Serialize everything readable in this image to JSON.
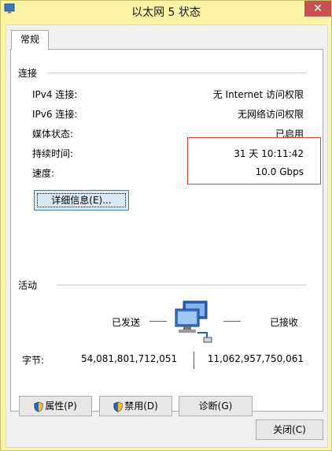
{
  "window": {
    "title": "以太网 5 状态",
    "close_glyph": "✕"
  },
  "tabs": [
    {
      "label": "常规"
    }
  ],
  "connection": {
    "heading": "连接",
    "rows": [
      {
        "label": "IPv4 连接:",
        "value": "无 Internet 访问权限"
      },
      {
        "label": "IPv6 连接:",
        "value": "无网络访问权限"
      },
      {
        "label": "媒体状态:",
        "value": "已启用"
      },
      {
        "label": "持续时间:",
        "value": "31 天 10:11:42"
      },
      {
        "label": "速度:",
        "value": "10.0 Gbps"
      }
    ],
    "details_button": "详细信息(E)..."
  },
  "activity": {
    "heading": "活动",
    "sent_label": "已发送",
    "received_label": "已接收",
    "bytes_label": "字节:",
    "bytes_sent": "54,081,801,712,051",
    "bytes_received": "11,062,957,750,061",
    "network_icon": "network-computers-icon"
  },
  "buttons": {
    "properties": "属性(P)",
    "disable": "禁用(D)",
    "diagnose": "诊断(G)",
    "close": "关闭(C)"
  },
  "colors": {
    "titlebar": "#fbf4a6",
    "close_button": "#c75050",
    "highlight_box": "#e0432f"
  }
}
